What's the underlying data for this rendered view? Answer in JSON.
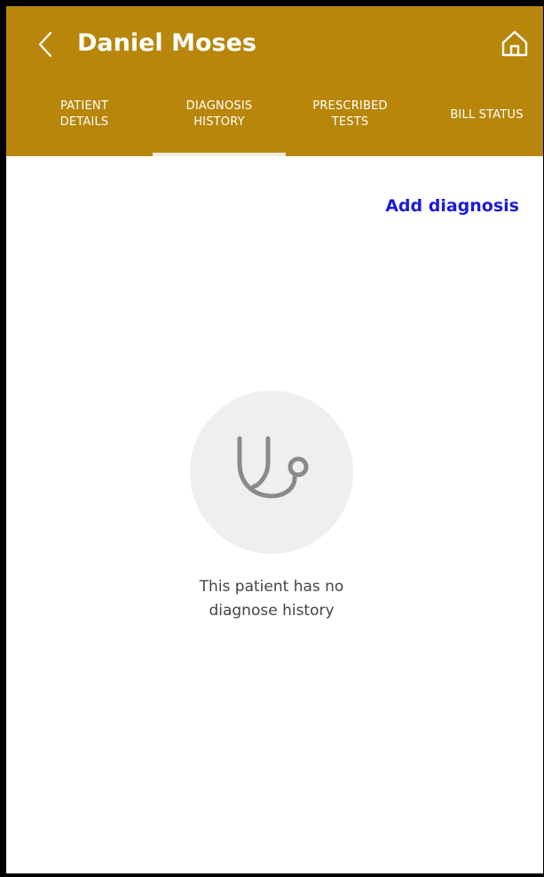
{
  "header": {
    "title": "Daniel Moses",
    "back_icon": "chevron-left-icon",
    "home_icon": "home-icon",
    "background_color": "#b8860b"
  },
  "tabs": [
    {
      "label": "PATIENT\nDETAILS",
      "selected": false
    },
    {
      "label": "DIAGNOSIS\nHISTORY",
      "selected": true
    },
    {
      "label": "PRESCRIBED\nTESTS",
      "selected": false
    },
    {
      "label": "BILL STATUS",
      "selected": false
    }
  ],
  "content": {
    "add_label": "Add diagnosis",
    "add_color": "#1b1bd6",
    "empty_icon": "stethoscope-icon",
    "empty_message": "This patient has no\ndiagnose history"
  }
}
